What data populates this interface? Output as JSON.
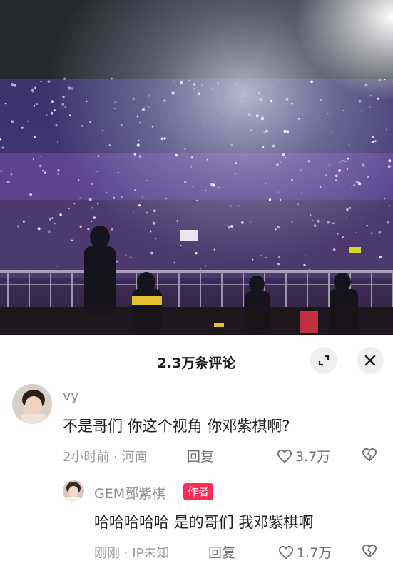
{
  "sheet": {
    "title": "2.3万条评论"
  },
  "comments": [
    {
      "username": "vy",
      "text": "不是哥们  你这个视角  你邓紫棋啊?",
      "time": "2小时前",
      "location": "河南",
      "reply_label": "回复",
      "likes": "3.7万",
      "avatar_icon": "user-avatar-photo"
    },
    {
      "username": "GEM鄧紫棋",
      "author_badge": "作者",
      "text": "哈哈哈哈哈  是的哥们  我邓紫棋啊",
      "time": "刚刚",
      "location": "IP未知",
      "reply_label": "回复",
      "likes": "1.7万",
      "avatar_icon": "author-avatar-photo"
    }
  ],
  "colors": {
    "badge": "#ff2b55",
    "text_primary": "#1f1f1f",
    "text_secondary": "#9a9a9a"
  },
  "icons": [
    "expand-icon",
    "close-icon",
    "heart-icon",
    "broken-heart-icon"
  ]
}
